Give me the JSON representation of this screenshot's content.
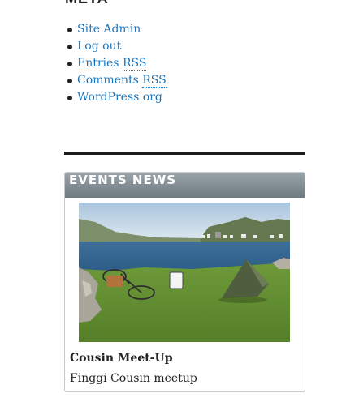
{
  "meta": {
    "heading": "META",
    "links": [
      {
        "text": "Site Admin"
      },
      {
        "text": "Log out"
      },
      {
        "text": "Entries ",
        "abbr": "RSS"
      },
      {
        "text": "Comments ",
        "abbr": "RSS"
      },
      {
        "text": "WordPress.org"
      }
    ]
  },
  "events": {
    "heading": "EVENTS NEWS",
    "title": "Cousin Meet-Up",
    "description": "Finggi Cousin meetup"
  },
  "colors": {
    "link": "#1b75bb",
    "header_gradient_top": "#9aa4aa",
    "header_gradient_bottom": "#6e7a80"
  }
}
